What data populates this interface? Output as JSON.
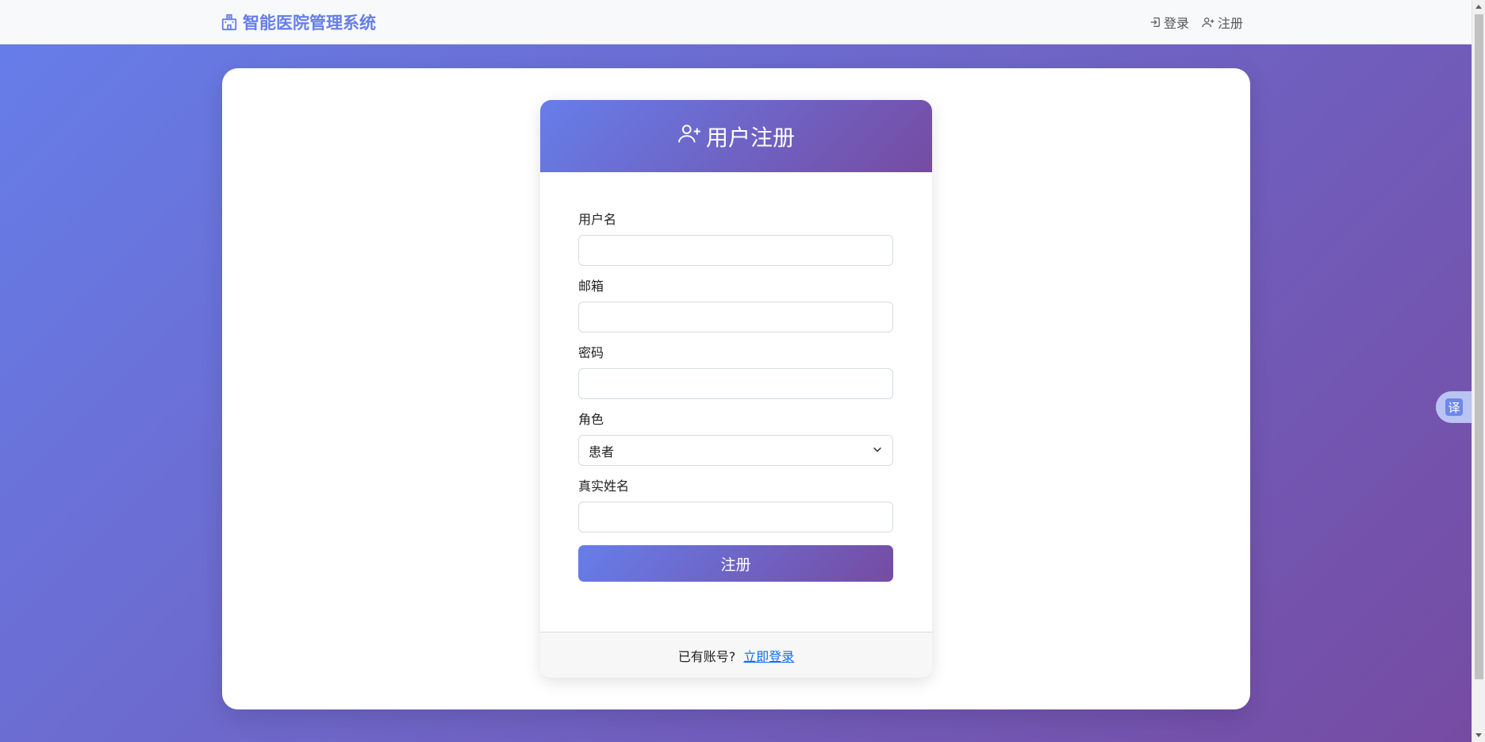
{
  "navbar": {
    "brand": "智能医院管理系统",
    "brand_icon": "hospital-icon",
    "links": [
      {
        "label": "登录",
        "icon": "login-icon"
      },
      {
        "label": "注册",
        "icon": "user-plus-icon"
      }
    ]
  },
  "register": {
    "title": "用户注册",
    "title_icon": "user-plus-icon",
    "fields": {
      "username": {
        "label": "用户名",
        "value": ""
      },
      "email": {
        "label": "邮箱",
        "value": ""
      },
      "password": {
        "label": "密码",
        "value": ""
      },
      "role": {
        "label": "角色",
        "selected": "患者"
      },
      "realname": {
        "label": "真实姓名",
        "value": ""
      }
    },
    "submit_label": "注册",
    "footer_text": "已有账号?",
    "footer_link": "立即登录"
  },
  "translate": {
    "glyph": "译"
  },
  "colors": {
    "gradient_start": "#667eea",
    "gradient_end": "#764ba2",
    "link": "#0d6efd"
  }
}
